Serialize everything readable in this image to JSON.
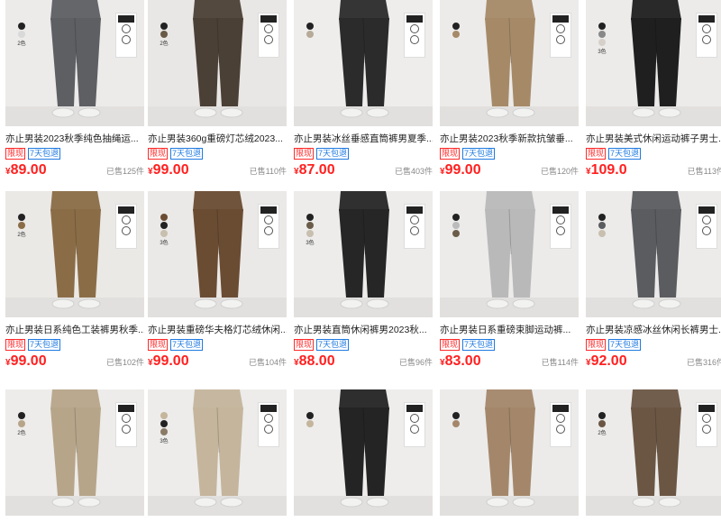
{
  "products": [
    {
      "title": "亦止男装2023秋季纯色抽绳运...",
      "badge_limit": "限现",
      "badge_return": "7天包退",
      "currency": "¥",
      "price": "89.00",
      "sold": "已售125件",
      "pants_color": "#5d5f63",
      "bg_color": "#ecebea",
      "swatch_count": "2色",
      "swatches": [
        "#222222",
        "#d9d9d9"
      ]
    },
    {
      "title": "亦止男装360g重磅灯芯绒2023...",
      "badge_limit": "限现",
      "badge_return": "7天包退",
      "currency": "¥",
      "price": "99.00",
      "sold": "已售110件",
      "pants_color": "#4b4036",
      "bg_color": "#e9e7e5",
      "swatch_count": "2色",
      "swatches": [
        "#222222",
        "#6a5a48"
      ]
    },
    {
      "title": "亦止男装冰丝垂感直筒裤男夏季...",
      "badge_limit": "限现",
      "badge_return": "7天包退",
      "currency": "¥",
      "price": "87.00",
      "sold": "已售403件",
      "pants_color": "#2b2b2c",
      "bg_color": "#eeedec",
      "swatch_count": "",
      "swatches": [
        "#222222",
        "#b7aa98"
      ]
    },
    {
      "title": "亦止男装2023秋季新款抗皱垂...",
      "badge_limit": "限现",
      "badge_return": "7天包退",
      "currency": "¥",
      "price": "99.00",
      "sold": "已售120件",
      "pants_color": "#a68a68",
      "bg_color": "#ecebea",
      "swatch_count": "",
      "swatches": [
        "#222222",
        "#a68a68"
      ]
    },
    {
      "title": "亦止男装美式休闲运动裤子男士...",
      "badge_limit": "限现",
      "badge_return": "7天包退",
      "currency": "¥",
      "price": "109.0",
      "sold": "已售113件",
      "pants_color": "#1f1f20",
      "bg_color": "#ecebea",
      "swatch_count": "3色",
      "swatches": [
        "#222222",
        "#888888",
        "#d5d0c8"
      ]
    },
    {
      "title": "亦止男装日系纯色工装裤男秋季...",
      "badge_limit": "限现",
      "badge_return": "7天包退",
      "currency": "¥",
      "price": "99.00",
      "sold": "已售102件",
      "pants_color": "#8a6d47",
      "bg_color": "#ebe9e6",
      "swatch_count": "2色",
      "swatches": [
        "#222222",
        "#8a6d47"
      ]
    },
    {
      "title": "亦止男装重磅华夫格灯芯绒休闲...",
      "badge_limit": "限现",
      "badge_return": "7天包退",
      "currency": "¥",
      "price": "99.00",
      "sold": "已售104件",
      "pants_color": "#6a4c33",
      "bg_color": "#ebe9e7",
      "swatch_count": "3色",
      "swatches": [
        "#6a4c33",
        "#222222",
        "#c8bfae"
      ]
    },
    {
      "title": "亦止男装直筒休闲裤男2023秋...",
      "badge_limit": "限现",
      "badge_return": "7天包退",
      "currency": "¥",
      "price": "88.00",
      "sold": "已售96件",
      "pants_color": "#262627",
      "bg_color": "#edeceb",
      "swatch_count": "3色",
      "swatches": [
        "#222222",
        "#6b5c4a",
        "#c8bfae"
      ]
    },
    {
      "title": "亦止男装日系重磅束脚运动裤...",
      "badge_limit": "限现",
      "badge_return": "7天包退",
      "currency": "¥",
      "price": "83.00",
      "sold": "已售114件",
      "pants_color": "#b9b9ba",
      "bg_color": "#ecebea",
      "swatch_count": "",
      "swatches": [
        "#222222",
        "#bbbbbb",
        "#6b5c4a"
      ]
    },
    {
      "title": "亦止男装凉感冰丝休闲长裤男士...",
      "badge_limit": "限现",
      "badge_return": "7天包退",
      "currency": "¥",
      "price": "92.00",
      "sold": "已售316件",
      "pants_color": "#5a5c60",
      "bg_color": "#ecebea",
      "swatch_count": "",
      "swatches": [
        "#222222",
        "#5a5c60",
        "#c8bfae"
      ]
    },
    {
      "title": "",
      "badge_limit": "",
      "badge_return": "",
      "currency": "",
      "price": "",
      "sold": "",
      "pants_color": "#b7a58a",
      "bg_color": "#edecea",
      "swatch_count": "2色",
      "swatches": [
        "#222222",
        "#b7a58a"
      ]
    },
    {
      "title": "",
      "badge_limit": "",
      "badge_return": "",
      "currency": "",
      "price": "",
      "sold": "",
      "pants_color": "#c4b59c",
      "bg_color": "#edeceb",
      "swatch_count": "3色",
      "swatches": [
        "#c4b59c",
        "#222222",
        "#8a7a66"
      ]
    },
    {
      "title": "",
      "badge_limit": "",
      "badge_return": "",
      "currency": "",
      "price": "",
      "sold": "",
      "pants_color": "#242425",
      "bg_color": "#eeedec",
      "swatch_count": "",
      "swatches": [
        "#222222",
        "#c4b59c"
      ]
    },
    {
      "title": "",
      "badge_limit": "",
      "badge_return": "",
      "currency": "",
      "price": "",
      "sold": "",
      "pants_color": "#a4876a",
      "bg_color": "#ecebea",
      "swatch_count": "",
      "swatches": [
        "#222222",
        "#a4876a"
      ]
    },
    {
      "title": "",
      "badge_limit": "",
      "badge_return": "",
      "currency": "",
      "price": "",
      "sold": "",
      "pants_color": "#6b5644",
      "bg_color": "#ecebea",
      "swatch_count": "2色",
      "swatches": [
        "#222222",
        "#6b5644"
      ]
    }
  ]
}
